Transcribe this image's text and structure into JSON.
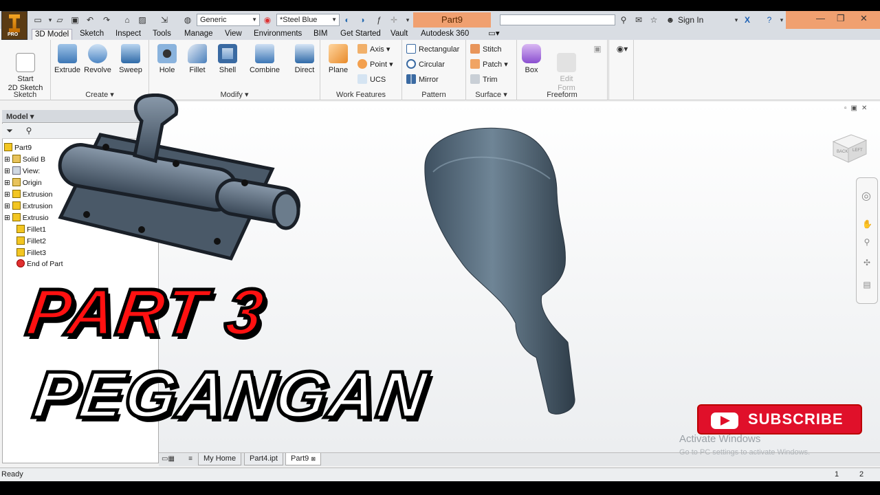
{
  "app": {
    "brand_badge": "PRO"
  },
  "titlebar": {
    "material": "Generic",
    "appearance": "*Steel Blue",
    "document_title": "Part9",
    "sign_in": "Sign In"
  },
  "menu": [
    "3D Model",
    "Sketch",
    "Inspect",
    "Tools",
    "Manage",
    "View",
    "Environments",
    "BIM",
    "Get Started",
    "Vault",
    "Autodesk 360"
  ],
  "ribbon": {
    "panels": {
      "sketch": "Sketch",
      "create": "Create ▾",
      "modify": "Modify ▾",
      "work_features": "Work Features",
      "pattern": "Pattern",
      "surface": "Surface ▾",
      "freeform": "Freeform"
    },
    "tools": {
      "start_sketch": "Start\n2D Sketch",
      "extrude": "Extrude",
      "revolve": "Revolve",
      "sweep": "Sweep",
      "hole": "Hole",
      "fillet": "Fillet",
      "shell": "Shell",
      "combine": "Combine",
      "direct": "Direct",
      "plane": "Plane",
      "axis": "Axis",
      "point": "Point",
      "ucs": "UCS",
      "rectangular": "Rectangular",
      "circular": "Circular",
      "mirror": "Mirror",
      "stitch": "Stitch",
      "patch": "Patch",
      "trim": "Trim",
      "box": "Box",
      "edit_form": "Edit\nForm"
    }
  },
  "browser": {
    "header": "Model ▾",
    "tree": [
      "Part9",
      "Solid B",
      "View:",
      "Origin",
      "Extrusion",
      "Extrusion",
      "Extrusio",
      "Fillet1",
      "Fillet2",
      "Fillet3",
      "End of Part"
    ]
  },
  "viewcube": {
    "face_front": "BACK",
    "face_left": "LEFT"
  },
  "tabs": [
    "My Home",
    "Part4.ipt",
    "Part9"
  ],
  "status": {
    "text": "Ready",
    "count1": "1",
    "count2": "2"
  },
  "overlay": {
    "line1": "PART 3",
    "line2": "PEGANGAN",
    "subscribe": "SUBSCRIBE",
    "activate_title": "Activate Windows",
    "activate_sub": "Go to PC settings to activate Windows."
  }
}
